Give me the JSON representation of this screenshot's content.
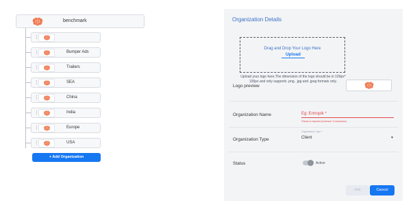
{
  "tree": {
    "root": {
      "name": "benchmark",
      "logo_icon": "brain-logo-icon"
    },
    "children": [
      {
        "name": ""
      },
      {
        "name": "Bumper Ads"
      },
      {
        "name": "Trailers"
      },
      {
        "name": "SEA"
      },
      {
        "name": "China"
      },
      {
        "name": "India"
      },
      {
        "name": "Europe"
      },
      {
        "name": "USA"
      }
    ],
    "add_button_label": "+ Add Organization"
  },
  "details": {
    "title": "Organization Details",
    "dropzone": {
      "title": "Drag and Drop Your Logo Here",
      "upload_label": "Upload",
      "help_text": "Upload your logo here.The dimension of the logo should be in 100px* 100px and only supports .png, .jpg and .jpeg formats only."
    },
    "logo_preview_label": "Logo preview",
    "name_label": "Organization Name",
    "name_placeholder": "Eg: Entropik *",
    "name_error": "*Name is required (minimum 3 characters)",
    "type_label": "Organization Type",
    "type_floating_label": "Organization Type *",
    "type_value": "Client",
    "status_label": "Status",
    "status_value": "Active",
    "add_button_label": "Add",
    "cancel_button_label": "Cancel"
  },
  "colors": {
    "accent": "#1677f2",
    "title_blue": "#3a6fc4",
    "error": "#e0474c",
    "logo_orange": "#ef7c55"
  }
}
